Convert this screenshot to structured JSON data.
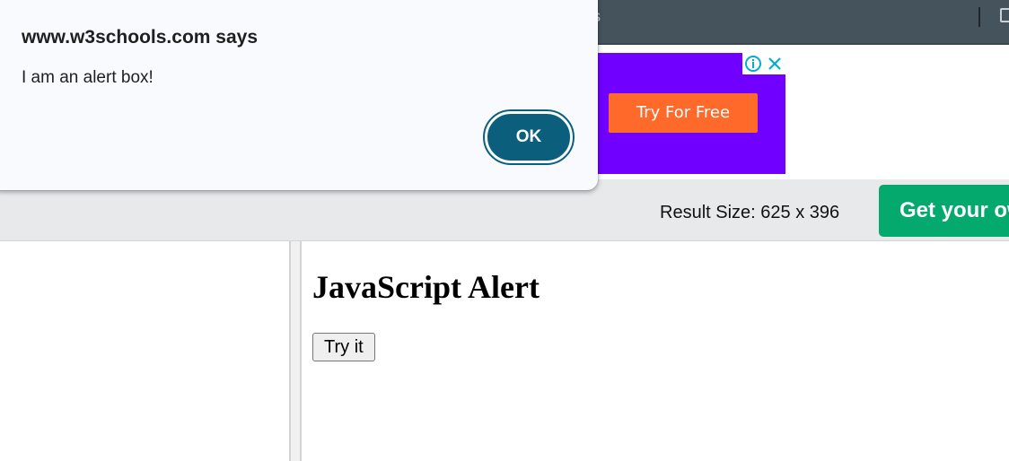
{
  "browser_bar": {
    "edge_text": "s"
  },
  "ad": {
    "cta_label": "Try For Free",
    "background_color": "#7000ff",
    "cta_color": "#ff6a2b",
    "info_icon": "info-icon",
    "close_icon": "close-icon"
  },
  "toolbar": {
    "result_size": "Result Size: 625 x 396",
    "get_own_label": "Get your own website",
    "get_own_color": "#04aa6d"
  },
  "result": {
    "heading": "JavaScript Alert",
    "button_label": "Try it"
  },
  "alert": {
    "title": "www.w3schools.com says",
    "message": "I am an alert box!",
    "ok_label": "OK",
    "ok_color": "#0b5f7d"
  }
}
